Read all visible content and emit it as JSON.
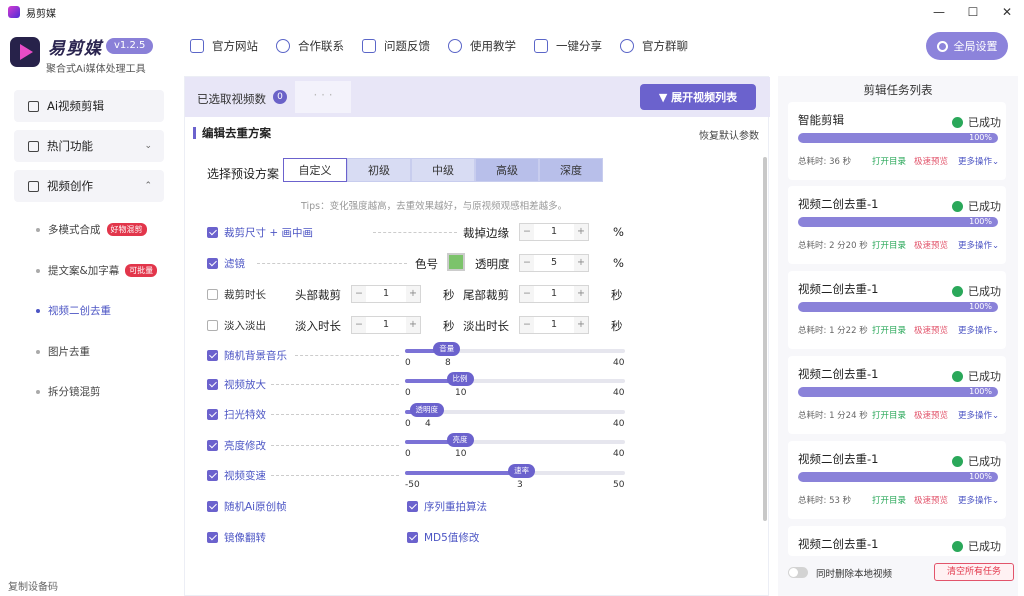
{
  "window": {
    "title": "易剪媒",
    "minimize": "—",
    "maximize": "☐",
    "close": "✕"
  },
  "app": {
    "brand": "易剪媒",
    "version": "v1.2.5",
    "subtitle": "聚合式Ai媒体处理工具"
  },
  "nav": [
    {
      "label": "官方网站",
      "icon": "grid-icon"
    },
    {
      "label": "合作联系",
      "icon": "users-icon"
    },
    {
      "label": "问题反馈",
      "icon": "message-icon"
    },
    {
      "label": "使用教学",
      "icon": "help-icon"
    },
    {
      "label": "一键分享",
      "icon": "share-icon"
    },
    {
      "label": "官方群聊",
      "icon": "chat-icon"
    }
  ],
  "global_settings": "全局设置",
  "sidebar": {
    "items": [
      {
        "label": "Ai视频剪辑",
        "icon": "video-icon"
      },
      {
        "label": "热门功能",
        "icon": "apps-icon",
        "chevron": "⌄"
      },
      {
        "label": "视频创作",
        "icon": "play-icon",
        "chevron": "⌃"
      }
    ],
    "subitems": [
      {
        "label": "多模式合成",
        "badge": "好物混剪"
      },
      {
        "label": "提文案&加字幕",
        "badge": "可批量"
      },
      {
        "label": "视频二创去重"
      },
      {
        "label": "图片去重"
      },
      {
        "label": "拆分镜混剪"
      }
    ],
    "copy_code": "复制设备码"
  },
  "main": {
    "selected_label": "已选取视频数",
    "selected_count": "0",
    "dots": "· · ·",
    "expand_button": "▼ 展开视频列表",
    "section_title": "编辑去重方案",
    "reset": "恢复默认参数",
    "preset_label": "选择预设方案",
    "presets": [
      "自定义",
      "初级",
      "中级",
      "高级",
      "深度"
    ],
    "tips": "Tips：变化强度越高，去重效果越好，与原视频观感相差越多。",
    "rows": {
      "crop": {
        "label": "裁剪尺寸 + 画中画",
        "checked": true,
        "field": "裁掉边缘",
        "value": "1",
        "unit": "%"
      },
      "filter": {
        "label": "滤镜",
        "checked": true,
        "color_label": "色号",
        "color": "#7cc36b",
        "field": "透明度",
        "value": "5",
        "unit": "%"
      },
      "trim": {
        "label": "裁剪时长",
        "checked": false,
        "head": "头部裁剪",
        "head_value": "1",
        "head_unit": "秒",
        "tail": "尾部裁剪",
        "tail_value": "1",
        "tail_unit": "秒"
      },
      "fade": {
        "label": "淡入淡出",
        "checked": false,
        "in": "淡入时长",
        "in_value": "1",
        "in_unit": "秒",
        "out": "淡出时长",
        "out_value": "1",
        "out_unit": "秒"
      }
    },
    "sliders": [
      {
        "label": "随机背景音乐",
        "pill": "音量",
        "min": "-",
        "max": "40",
        "value": "8",
        "min_label": "0",
        "fraction": 0.19
      },
      {
        "label": "视频放大",
        "pill": "比例",
        "max": "40",
        "value": "10",
        "min_label": "0",
        "fraction": 0.25
      },
      {
        "label": "扫光特效",
        "pill": "透明度",
        "max": "40",
        "value": "4",
        "min_label": "0",
        "fraction": 0.1
      },
      {
        "label": "亮度修改",
        "pill": "亮度",
        "max": "40",
        "value": "10",
        "min_label": "0",
        "fraction": 0.25
      },
      {
        "label": "视频变速",
        "pill": "速率",
        "max": "50",
        "value": "3",
        "min_label": "-50",
        "fraction": 0.53
      }
    ],
    "checks_left": [
      {
        "label": "随机Ai原创帧",
        "checked": true
      },
      {
        "label": "镜像翻转",
        "checked": true
      }
    ],
    "checks_right": [
      {
        "label": "序列重拍算法",
        "checked": true
      },
      {
        "label": "MD5值修改",
        "checked": true
      }
    ],
    "stepper_minus": "−",
    "stepper_plus": "+"
  },
  "tasks": {
    "title": "剪辑任务列表",
    "list": [
      {
        "name": "智能剪辑",
        "status": "已成功",
        "progress": "100%",
        "time": "总耗时: 36 秒"
      },
      {
        "name": "视频二创去重-1",
        "status": "已成功",
        "progress": "100%",
        "time": "总耗时: 2 分20 秒"
      },
      {
        "name": "视频二创去重-1",
        "status": "已成功",
        "progress": "100%",
        "time": "总耗时: 1 分22 秒"
      },
      {
        "name": "视频二创去重-1",
        "status": "已成功",
        "progress": "100%",
        "time": "总耗时: 1 分24 秒"
      },
      {
        "name": "视频二创去重-1",
        "status": "已成功",
        "progress": "100%",
        "time": "总耗时: 53 秒"
      },
      {
        "name": "视频二创去重-1",
        "status": "已成功",
        "progress": "",
        "time": ""
      }
    ],
    "open_dir": "打开目录",
    "fast_preview": "极速预览",
    "more": "更多操作⌄",
    "delete_local": "同时删除本地视频",
    "clear_all": "清空所有任务"
  }
}
